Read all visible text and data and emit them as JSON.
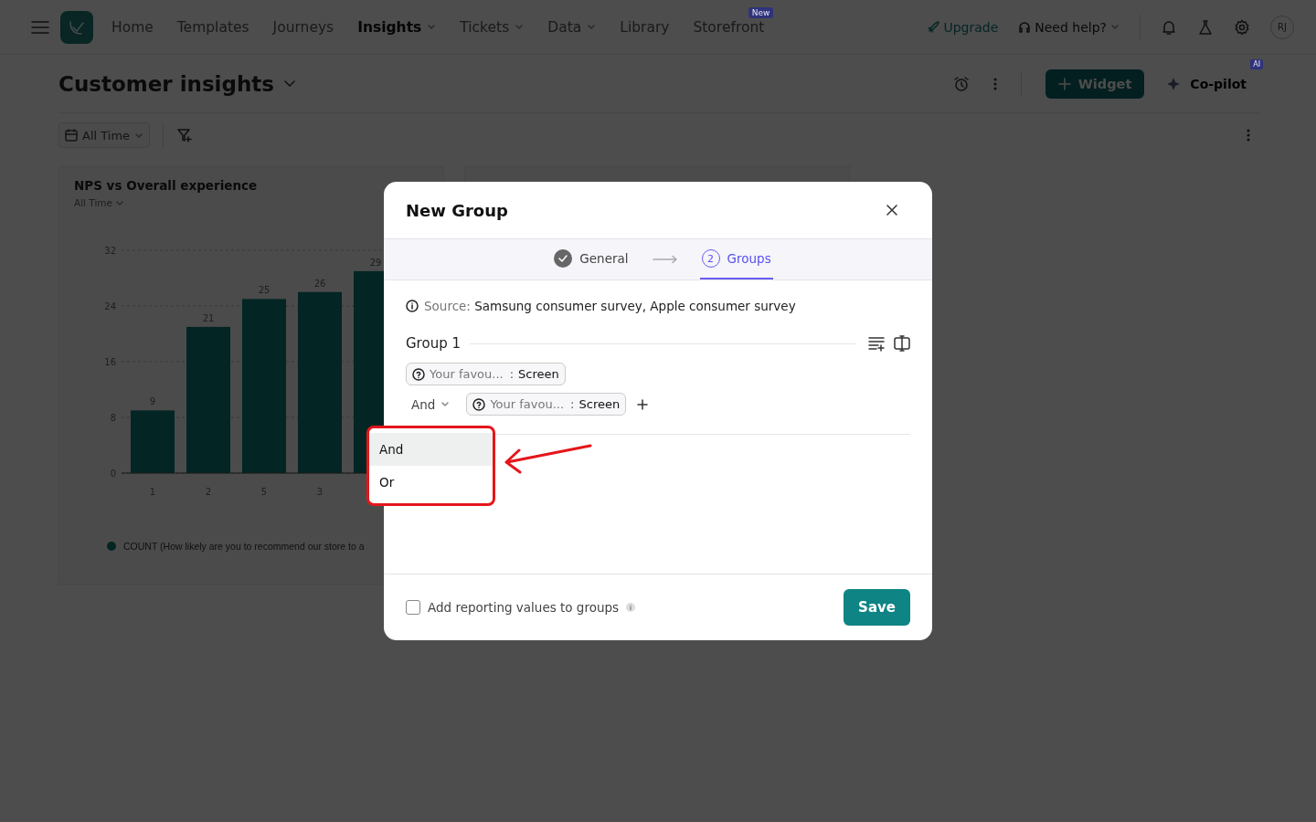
{
  "nav": {
    "items": [
      {
        "label": "Home",
        "selected": false,
        "caret": false
      },
      {
        "label": "Templates",
        "selected": false,
        "caret": false
      },
      {
        "label": "Journeys",
        "selected": false,
        "caret": false
      },
      {
        "label": "Insights",
        "selected": true,
        "caret": true
      },
      {
        "label": "Tickets",
        "selected": false,
        "caret": true
      },
      {
        "label": "Data",
        "selected": false,
        "caret": true
      },
      {
        "label": "Library",
        "selected": false,
        "caret": false
      },
      {
        "label": "Storefront",
        "selected": false,
        "caret": false,
        "badge": "New"
      }
    ],
    "upgrade": "Upgrade",
    "help": "Need help?",
    "avatar": "RJ"
  },
  "page": {
    "title": "Customer insights",
    "widget": "Widget",
    "copilot": "Co-pilot",
    "copilot_badge": "AI",
    "filter": "All Time"
  },
  "cards": [
    {
      "title": "NPS vs Overall experience",
      "subtitle": "All Time",
      "chart_data": {
        "type": "bar",
        "categories": [
          "1",
          "2",
          "5",
          "3",
          null
        ],
        "series": [
          {
            "name": "COUNT (How likely are you to recommend our store to a",
            "color": "#0b7a78",
            "values": [
              9,
              21,
              25,
              26,
              29
            ]
          }
        ],
        "ylim": [
          0,
          32
        ],
        "yticks": [
          0,
          8,
          16,
          24,
          32
        ],
        "grid": true,
        "data_labels": true
      }
    }
  ],
  "modal": {
    "title": "New Group",
    "steps": [
      {
        "label": "General",
        "completed": true,
        "selected": false
      },
      {
        "number": "2",
        "label": "Groups",
        "completed": false,
        "selected": true
      }
    ],
    "source_label": "Source:",
    "source": "Samsung consumer survey, Apple consumer survey",
    "group": {
      "title": "Group 1",
      "conditions": [
        {
          "field": "Your favou...",
          "separator": ":",
          "value": "Screen"
        },
        {
          "connector": "And",
          "field": "Your favou...",
          "separator": ":",
          "value": "Screen"
        }
      ]
    },
    "dropdown": [
      {
        "label": "And",
        "selected": true
      },
      {
        "label": "Or",
        "selected": false
      }
    ],
    "checkbox": {
      "label": "Add reporting values to groups",
      "checked": false
    },
    "save": "Save"
  }
}
